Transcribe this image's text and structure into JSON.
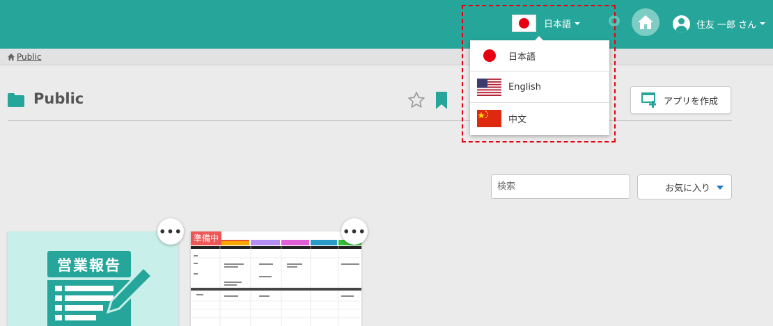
{
  "header": {
    "current_language": "日本語",
    "user_name": "住友 一郎 さん"
  },
  "breadcrumb": {
    "label": "Public"
  },
  "page": {
    "title": "Public",
    "create_app_label": "アプリを作成"
  },
  "search": {
    "placeholder": "検索"
  },
  "filter": {
    "selected": "お気に入り"
  },
  "language_menu": {
    "options": [
      {
        "label": "日本語",
        "flag": "japan-flag-icon"
      },
      {
        "label": "English",
        "flag": "us-flag-icon"
      },
      {
        "label": "中文",
        "flag": "china-flag-icon"
      }
    ]
  },
  "cards": [
    {
      "thumbnail_text": "営業報告",
      "more_label": "•••"
    },
    {
      "status": "準備中",
      "more_label": "•••"
    }
  ],
  "colors": {
    "header": "#26a69a",
    "accent": "#26a69a",
    "highlight": "#e60012",
    "badge": "#ee5757"
  }
}
